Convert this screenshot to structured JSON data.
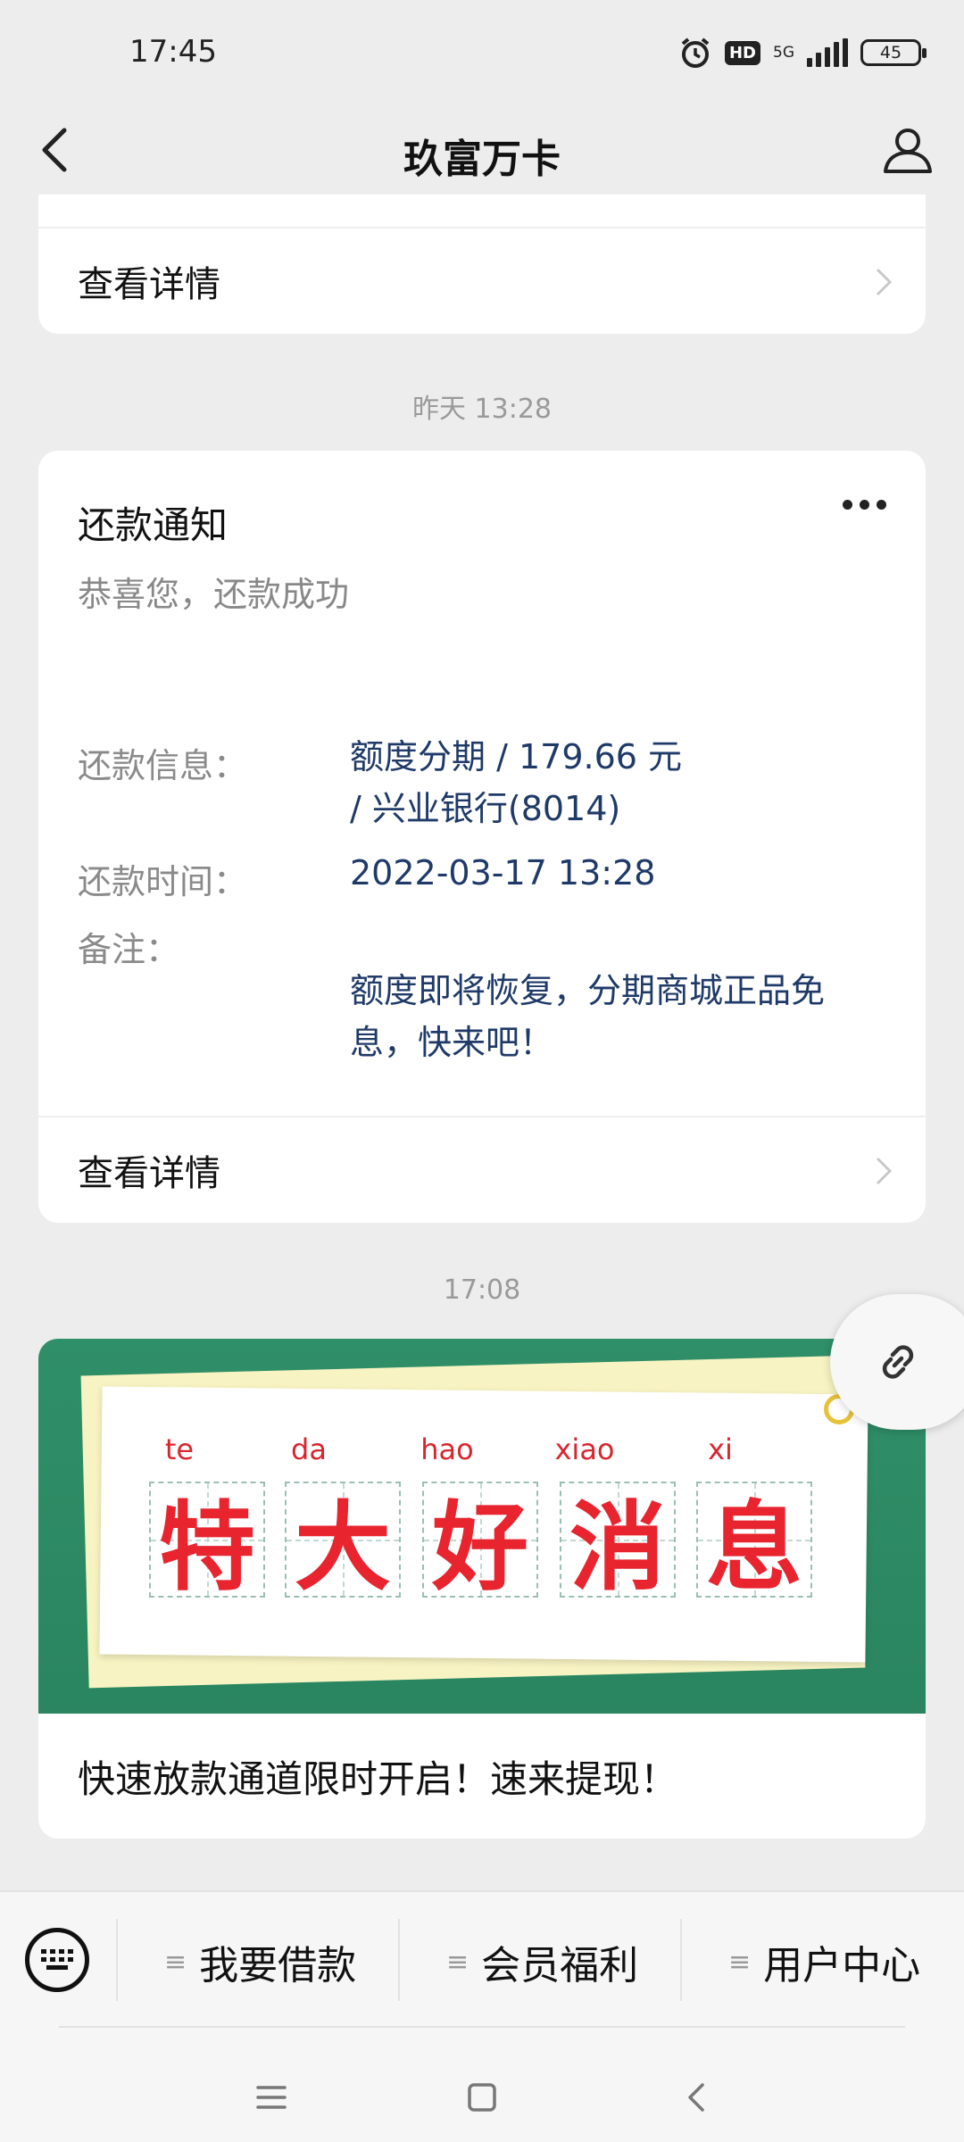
{
  "status_bar": {
    "time": "17:45",
    "hd": "HD",
    "network": "5G",
    "battery": "45"
  },
  "nav": {
    "title": "玖富万卡"
  },
  "first_card": {
    "detail_label": "查看详情"
  },
  "messages": [
    {
      "timestamp": "昨天 13:28"
    },
    {
      "timestamp": "17:08"
    }
  ],
  "notice": {
    "title": "还款通知",
    "subtitle": "恭喜您，还款成功",
    "info_label": "还款信息：",
    "info_value_line1": "额度分期 / 179.66 元",
    "info_value_line2": "/ 兴业银行(8014)",
    "time_label": "还款时间：",
    "time_value": "2022-03-17 13:28",
    "remark_label": "备注：",
    "remark_value": "额度即将恢复，分期商城正品免息，快来吧！",
    "detail_label": "查看详情"
  },
  "banner": {
    "pinyin": [
      "te",
      "da",
      "hao",
      "xiao",
      "xi"
    ],
    "characters": [
      "特",
      "大",
      "好",
      "消",
      "息"
    ],
    "caption": "快速放款通道限时开启！速来提现！"
  },
  "bottom_menu": {
    "items": [
      {
        "label": "我要借款"
      },
      {
        "label": "会员福利"
      },
      {
        "label": "用户中心"
      }
    ]
  },
  "icons": [
    "back-icon",
    "user-icon",
    "chevron-right-icon",
    "more-icon",
    "link-icon",
    "keyboard-icon",
    "menu-icon",
    "home-icon",
    "back-nav-icon"
  ],
  "colors": {
    "accent_value_text": "#1f3a68",
    "banner_green": "#2f8f68",
    "banner_red": "#e8242f"
  }
}
